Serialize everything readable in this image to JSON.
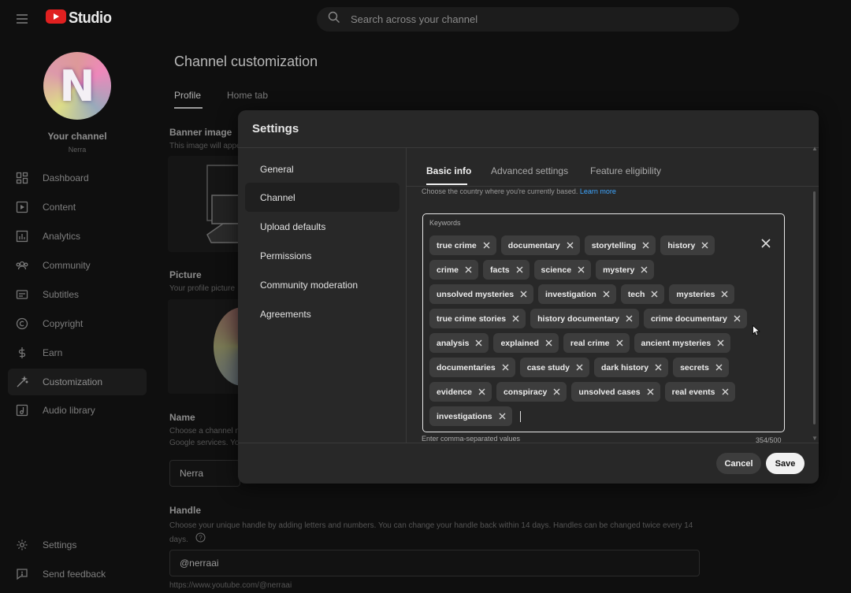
{
  "topbar": {
    "logo_text": "Studio",
    "search_placeholder": "Search across your channel"
  },
  "sidebar": {
    "avatar_letter": "N",
    "your_channel_label": "Your channel",
    "channel_name": "Nerra",
    "items": [
      {
        "label": "Dashboard",
        "icon": "dashboard-icon"
      },
      {
        "label": "Content",
        "icon": "content-icon"
      },
      {
        "label": "Analytics",
        "icon": "analytics-icon"
      },
      {
        "label": "Community",
        "icon": "community-icon"
      },
      {
        "label": "Subtitles",
        "icon": "subtitles-icon"
      },
      {
        "label": "Copyright",
        "icon": "copyright-icon"
      },
      {
        "label": "Earn",
        "icon": "earn-icon"
      },
      {
        "label": "Customization",
        "icon": "customization-icon",
        "active": true
      },
      {
        "label": "Audio library",
        "icon": "audio-library-icon"
      }
    ],
    "settings_label": "Settings",
    "feedback_label": "Send feedback"
  },
  "main": {
    "title": "Channel customization",
    "tabs": [
      "Profile",
      "Home tab"
    ],
    "banner_title": "Banner image",
    "banner_desc": "This image will appe",
    "picture_title": "Picture",
    "picture_desc": "Your profile picture",
    "name_title": "Name",
    "name_desc_1": "Choose a channel n",
    "name_desc_2": "Google services. Yo",
    "name_value": "Nerra",
    "handle_title": "Handle",
    "handle_desc": "Choose your unique handle by adding letters and numbers. You can change your handle back within 14 days. Handles can be changed twice every 14 days.",
    "handle_value": "@nerraai",
    "handle_url": "https://www.youtube.com/@nerraai"
  },
  "modal": {
    "title": "Settings",
    "nav": [
      "General",
      "Channel",
      "Upload defaults",
      "Permissions",
      "Community moderation",
      "Agreements"
    ],
    "active_nav": "Channel",
    "tabs": [
      "Basic info",
      "Advanced settings",
      "Feature eligibility"
    ],
    "active_tab": "Basic info",
    "country_note": "Choose the country where you're currently based.",
    "learn_more": "Learn more",
    "keywords_label": "Keywords",
    "keywords": [
      "true crime",
      "documentary",
      "storytelling",
      "history",
      "crime",
      "facts",
      "science",
      "mystery",
      "unsolved mysteries",
      "investigation",
      "tech",
      "mysteries",
      "true crime stories",
      "history documentary",
      "crime documentary",
      "analysis",
      "explained",
      "real crime",
      "ancient mysteries",
      "documentaries",
      "case study",
      "dark history",
      "secrets",
      "evidence",
      "conspiracy",
      "unsolved cases",
      "real events",
      "investigations"
    ],
    "keywords_hint": "Enter comma-separated values",
    "keywords_count": "354/500",
    "cancel_label": "Cancel",
    "save_label": "Save"
  },
  "colors": {
    "background": "#0f0f0f",
    "modal": "#282828",
    "chip": "#3d3d3d",
    "link": "#3ea6ff",
    "youtube_red": "#ff0000"
  }
}
